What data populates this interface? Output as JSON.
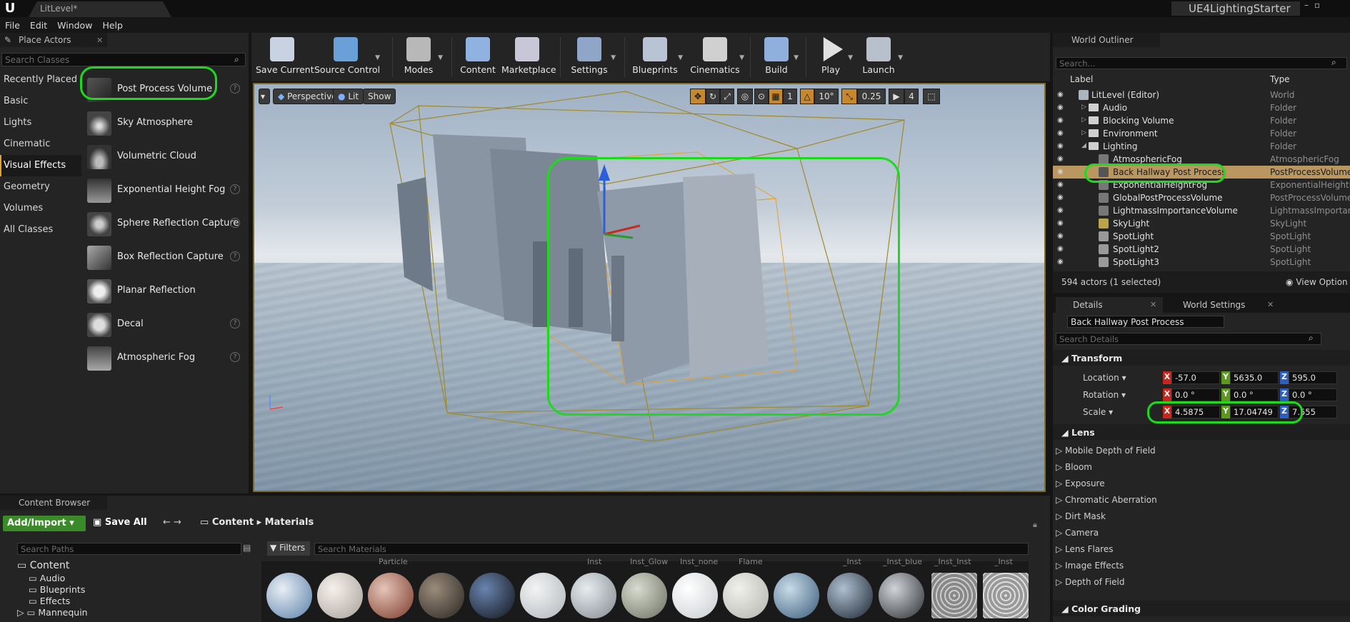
{
  "window": {
    "level_tab": "LitLevel*",
    "project_name": "UE4LightingStarter"
  },
  "menu": [
    "File",
    "Edit",
    "Window",
    "Help"
  ],
  "place_actors": {
    "tab": "Place Actors",
    "search_placeholder": "Search Classes",
    "categories": [
      "Recently Placed",
      "Basic",
      "Lights",
      "Cinematic",
      "Visual Effects",
      "Geometry",
      "Volumes",
      "All Classes"
    ],
    "selected_category": "Visual Effects",
    "items": [
      {
        "name": "Post Process Volume",
        "help": true,
        "icon": "post-process-volume-icon"
      },
      {
        "name": "Sky Atmosphere",
        "help": false,
        "icon": "sky-atmosphere-icon"
      },
      {
        "name": "Volumetric Cloud",
        "help": false,
        "icon": "volumetric-cloud-icon"
      },
      {
        "name": "Exponential Height Fog",
        "help": true,
        "icon": "height-fog-icon"
      },
      {
        "name": "Sphere Reflection Capture",
        "help": true,
        "icon": "sphere-reflection-icon"
      },
      {
        "name": "Box Reflection Capture",
        "help": true,
        "icon": "box-reflection-icon"
      },
      {
        "name": "Planar Reflection",
        "help": false,
        "icon": "planar-reflection-icon"
      },
      {
        "name": "Decal",
        "help": true,
        "icon": "decal-icon"
      },
      {
        "name": "Atmospheric Fog",
        "help": true,
        "icon": "atmospheric-fog-icon"
      }
    ]
  },
  "toolbar": {
    "items": [
      {
        "label": "Save Current",
        "icon": "save-icon",
        "color": "#c9d2e0"
      },
      {
        "label": "Source Control",
        "icon": "source-control-icon",
        "color": "#6aa0d8"
      },
      {
        "label": "Modes",
        "icon": "modes-icon",
        "color": "#b8b8b8"
      },
      {
        "label": "Content",
        "icon": "content-icon",
        "color": "#8fb2e0"
      },
      {
        "label": "Marketplace",
        "icon": "marketplace-icon",
        "color": "#c7c7d7"
      },
      {
        "label": "Settings",
        "icon": "settings-icon",
        "color": "#8fa6c8"
      },
      {
        "label": "Blueprints",
        "icon": "blueprints-icon",
        "color": "#b8c4d4"
      },
      {
        "label": "Cinematics",
        "icon": "cinematics-icon",
        "color": "#d0d0d0"
      },
      {
        "label": "Build",
        "icon": "build-icon",
        "color": "#8fb0dd"
      },
      {
        "label": "Play",
        "icon": "play-icon",
        "color": "#e0e0e0"
      },
      {
        "label": "Launch",
        "icon": "launch-icon",
        "color": "#b8c0cc"
      }
    ]
  },
  "viewport": {
    "perspective": "Perspective",
    "lit": "Lit",
    "show": "Show",
    "grid_snap": "1",
    "rotation_snap": "10°",
    "scale_snap": "0.25",
    "camera_speed": "4"
  },
  "outliner": {
    "tab": "World Outliner",
    "search_placeholder": "Search...",
    "col_label": "Label",
    "col_type": "Type",
    "rows": [
      {
        "label": "LitLevel (Editor)",
        "type": "World",
        "indent": 0,
        "kind": "world"
      },
      {
        "label": "Audio",
        "type": "Folder",
        "indent": 1,
        "kind": "folder"
      },
      {
        "label": "Blocking Volume",
        "type": "Folder",
        "indent": 1,
        "kind": "folder"
      },
      {
        "label": "Environment",
        "type": "Folder",
        "indent": 1,
        "kind": "folder"
      },
      {
        "label": "Lighting",
        "type": "Folder",
        "indent": 1,
        "kind": "folder"
      },
      {
        "label": "AtmosphericFog",
        "type": "AtmosphericFog",
        "indent": 2,
        "kind": "actor"
      },
      {
        "label": "Back Hallway Post Process",
        "type": "PostProcessVolume",
        "indent": 2,
        "kind": "actor",
        "selected": true
      },
      {
        "label": "ExponentialHeightFog",
        "type": "ExponentialHeightFog",
        "indent": 2,
        "kind": "actor"
      },
      {
        "label": "GlobalPostProcessVolume",
        "type": "PostProcessVolume",
        "indent": 2,
        "kind": "actor"
      },
      {
        "label": "LightmassImportanceVolume",
        "type": "LightmassImportance",
        "indent": 2,
        "kind": "actor"
      },
      {
        "label": "SkyLight",
        "type": "SkyLight",
        "indent": 2,
        "kind": "actor"
      },
      {
        "label": "SpotLight",
        "type": "SpotLight",
        "indent": 2,
        "kind": "actor"
      },
      {
        "label": "SpotLight2",
        "type": "SpotLight",
        "indent": 2,
        "kind": "actor"
      },
      {
        "label": "SpotLight3",
        "type": "SpotLight",
        "indent": 2,
        "kind": "actor"
      }
    ],
    "status": "594 actors (1 selected)",
    "view_options": "View Option"
  },
  "details": {
    "tab": "Details",
    "tab2": "World Settings",
    "actor_name": "Back Hallway Post Process",
    "search_placeholder": "Search Details",
    "transform_header": "Transform",
    "location_label": "Location",
    "rotation_label": "Rotation",
    "scale_label": "Scale",
    "location": {
      "x": "-57.0",
      "y": "5635.0",
      "z": "595.0"
    },
    "rotation": {
      "x": "0.0 °",
      "y": "0.0 °",
      "z": "0.0 °"
    },
    "scale": {
      "x": "4.5875",
      "y": "17.04749",
      "z": "7.555"
    },
    "lens_header": "Lens",
    "lens_items": [
      "Mobile Depth of Field",
      "Bloom",
      "Exposure",
      "Chromatic Aberration",
      "Dirt Mask",
      "Camera",
      "Lens Flares",
      "Image Effects",
      "Depth of Field"
    ],
    "color_grading_header": "Color Grading"
  },
  "content_browser": {
    "tab": "Content Browser",
    "add_import": "Add/Import",
    "save_all": "Save All",
    "path": [
      "Content",
      "Materials"
    ],
    "search_paths_placeholder": "Search Paths",
    "filters": "Filters",
    "search_placeholder": "Search Materials",
    "tree": [
      "Content",
      "Audio",
      "Blueprints",
      "Effects",
      "Mannequin"
    ],
    "thumb_captions": [
      "Particle",
      "Inst",
      "Inst_Glow",
      "Inst_none",
      "Flame",
      "_Inst",
      "_Inst_blue",
      "_Inst_Inst",
      "_Inst"
    ]
  },
  "colors": {
    "accent": "#e2a12d",
    "selection": "#b9975f",
    "highlight_ring": "#1ed91e"
  }
}
